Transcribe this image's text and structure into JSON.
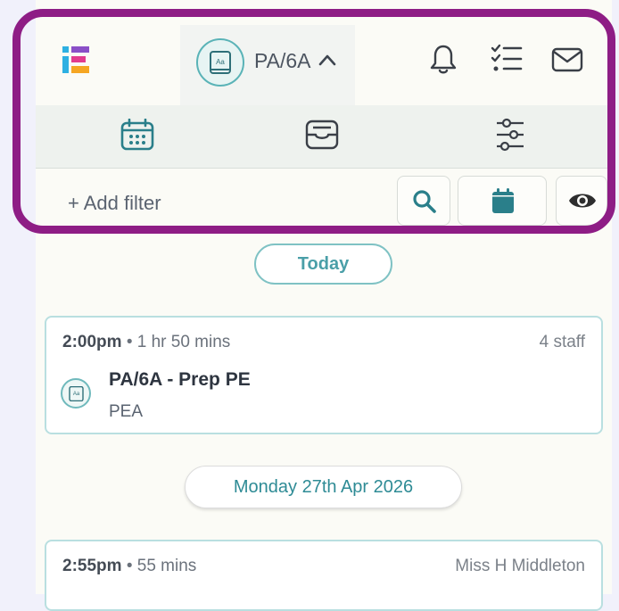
{
  "header": {
    "class_selector_label": "PA/6A",
    "class_icon_text": "Aa"
  },
  "filter": {
    "add_filter_label": "+ Add filter"
  },
  "timeline": {
    "today_label": "Today",
    "date_header": "Monday 27th Apr 2026"
  },
  "events": [
    {
      "time": "2:00pm",
      "separator": "•",
      "duration": "1 hr 50 mins",
      "staff": "4 staff",
      "title": "PA/6A - Prep PE",
      "subtitle": "PEA",
      "icon_text": "Aa"
    },
    {
      "time": "2:55pm",
      "separator": "•",
      "duration": "55 mins",
      "staff": "Miss H Middleton"
    }
  ],
  "colors": {
    "accent": "#2e8b95",
    "frame": "#8e1d85",
    "pill_border": "#7fc2c4"
  }
}
